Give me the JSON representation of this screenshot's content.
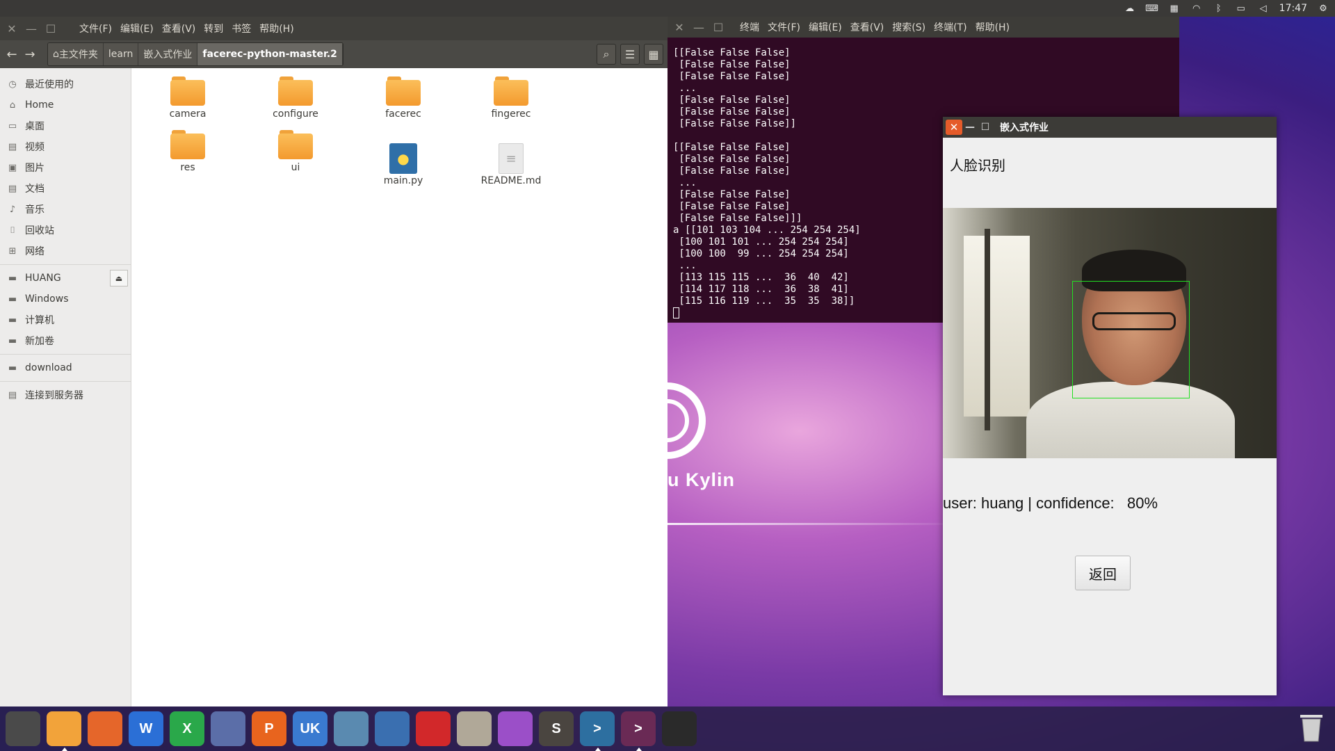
{
  "top_panel": {
    "clock": "17:47",
    "indicators": [
      "weather-icon",
      "keyboard-icon",
      "calendar-icon",
      "wifi-icon",
      "bluetooth-icon",
      "battery-icon",
      "volume-icon",
      "gear-icon"
    ]
  },
  "file_manager": {
    "menu": [
      "文件(F)",
      "编辑(E)",
      "查看(V)",
      "转到",
      "书签",
      "帮助(H)"
    ],
    "breadcrumbs": [
      "主文件夹",
      "learn",
      "嵌入式作业",
      "facerec-python-master.2"
    ],
    "sidebar": {
      "places": [
        "最近使用的",
        "Home",
        "桌面",
        "视频",
        "图片",
        "文档",
        "音乐",
        "回收站",
        "网络"
      ],
      "devices": [
        "HUANG",
        "Windows",
        "计算机",
        "新加卷"
      ],
      "bookmarks": [
        "download"
      ],
      "network": [
        "连接到服务器"
      ]
    },
    "files": [
      "camera",
      "configure",
      "facerec",
      "fingerec",
      "res",
      "ui",
      "main.py",
      "README.md"
    ]
  },
  "terminal": {
    "menu": [
      "终端",
      "文件(F)",
      "编辑(E)",
      "查看(V)",
      "搜索(S)",
      "终端(T)",
      "帮助(H)"
    ],
    "output": "[[False False False]\n [False False False]\n [False False False]\n ...\n [False False False]\n [False False False]\n [False False False]]\n\n[[False False False]\n [False False False]\n [False False False]\n ...\n [False False False]\n [False False False]\n [False False False]]]\na [[101 103 104 ... 254 254 254]\n [100 101 101 ... 254 254 254]\n [100 100  99 ... 254 254 254]\n ...\n [113 115 115 ...  36  40  42]\n [114 117 118 ...  36  38  41]\n [115 116 119 ...  35  35  38]]"
  },
  "desktop": {
    "logo_text": "u Kylin"
  },
  "dialog": {
    "title": "嵌入式作业",
    "heading": "人脸识别",
    "result": "user: huang | confidence:   80%",
    "back_button": "返回"
  },
  "dock": {
    "apps": [
      {
        "name": "dash-icon",
        "color": "#4a4a4a"
      },
      {
        "name": "files-icon",
        "color": "#f2a33a"
      },
      {
        "name": "firefox-icon",
        "color": "#e5662a"
      },
      {
        "name": "wps-writer-icon",
        "color": "#2b6fd6",
        "glyph": "W"
      },
      {
        "name": "wps-spreadsheet-icon",
        "color": "#2aa84a",
        "glyph": "X"
      },
      {
        "name": "chromium-icon",
        "color": "#5b6ea8"
      },
      {
        "name": "wps-presentation-icon",
        "color": "#e8641e",
        "glyph": "P"
      },
      {
        "name": "software-center-icon",
        "color": "#3a7ad0",
        "glyph": "UK"
      },
      {
        "name": "system-installer-icon",
        "color": "#5a8ab0"
      },
      {
        "name": "app-grid-icon",
        "color": "#3a6fb0"
      },
      {
        "name": "netease-music-icon",
        "color": "#d2282a"
      },
      {
        "name": "compass-icon",
        "color": "#b0a898"
      },
      {
        "name": "editor-icon",
        "color": "#9b4fc8"
      },
      {
        "name": "sublime-text-icon",
        "color": "#4a4540",
        "glyph": "S"
      },
      {
        "name": "code-terminal-icon",
        "color": "#2d6fa0",
        "glyph": ">"
      },
      {
        "name": "terminal-app-icon",
        "color": "#6a2a55",
        "glyph": ">"
      },
      {
        "name": "usb-drive-icon",
        "color": "#2a2a2a"
      }
    ]
  }
}
